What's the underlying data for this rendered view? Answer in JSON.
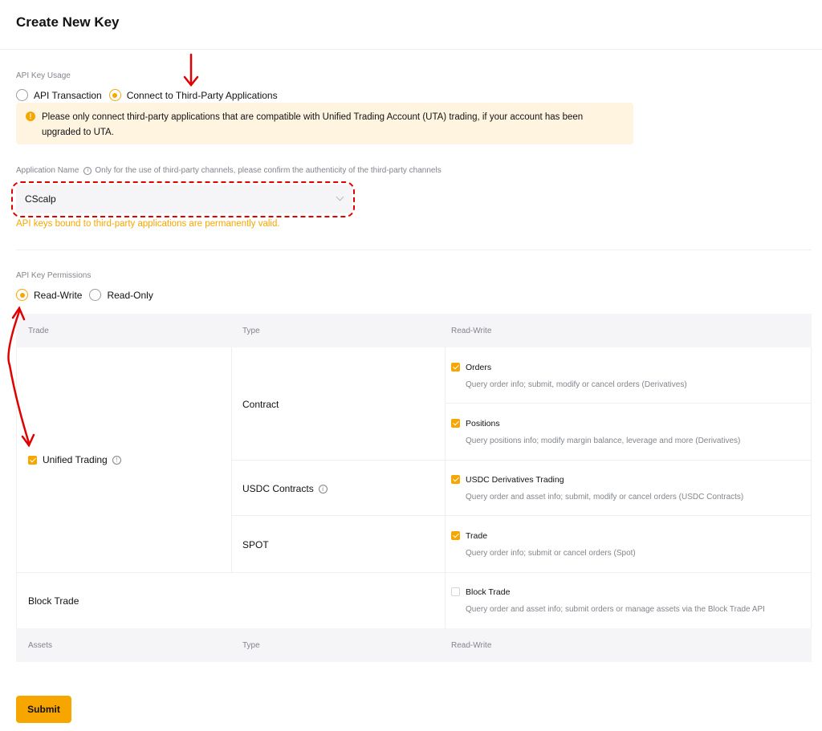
{
  "page_title": "Create New Key",
  "api_key_usage": {
    "label": "API Key Usage",
    "options": [
      {
        "label": "API Transaction",
        "checked": false
      },
      {
        "label": "Connect to Third-Party Applications",
        "checked": true
      }
    ]
  },
  "notice": {
    "icon": "exclamation-icon",
    "line1": "Please only connect third-party applications that are compatible with Unified Trading Account (UTA) trading, if your account has been",
    "line2": "upgraded to UTA."
  },
  "application_name": {
    "label": "Application Name",
    "hint": "Only for the use of third-party channels, please confirm the authenticity of the third-party channels",
    "selected": "CScalp",
    "warning": "API keys bound to third-party applications are permanently valid."
  },
  "permissions": {
    "label": "API Key Permissions",
    "options": [
      {
        "label": "Read-Write",
        "checked": true
      },
      {
        "label": "Read-Only",
        "checked": false
      }
    ]
  },
  "trade_table": {
    "headers": [
      "Trade",
      "Type",
      "Read-Write"
    ],
    "group": "Unified Trading",
    "types": [
      "Contract",
      "USDC Contracts",
      "SPOT"
    ],
    "perms": [
      {
        "title": "Orders",
        "desc": "Query order info; submit, modify or cancel orders (Derivatives)",
        "checked": true
      },
      {
        "title": "Positions",
        "desc": "Query positions info; modify margin balance, leverage and more (Derivatives)",
        "checked": true
      },
      {
        "title": "USDC Derivatives Trading",
        "desc": "Query order and asset info; submit, modify or cancel orders (USDC Contracts)",
        "checked": true
      },
      {
        "title": "Trade",
        "desc": "Query order info; submit or cancel orders (Spot)",
        "checked": true
      }
    ],
    "block_trade": {
      "label": "Block Trade",
      "title": "Block Trade",
      "desc": "Query order and asset info; submit orders or manage assets via the Block Trade API",
      "checked": false
    }
  },
  "assets_table": {
    "headers": [
      "Assets",
      "Type",
      "Read-Write"
    ]
  },
  "submit_label": "Submit",
  "colors": {
    "accent": "#f7a600",
    "annotation": "#e00000"
  }
}
